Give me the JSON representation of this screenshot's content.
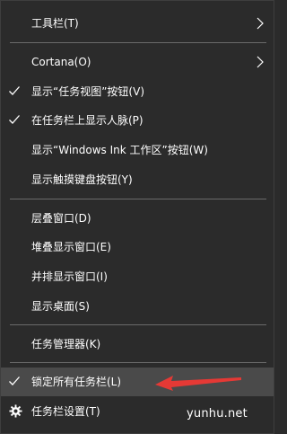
{
  "menu": {
    "items": [
      {
        "label": "工具栏(T)",
        "checked": false,
        "submenu": true
      },
      {
        "label": "Cortana(O)",
        "checked": false,
        "submenu": true
      },
      {
        "label": "显示“任务视图”按钮(V)",
        "checked": true,
        "submenu": false
      },
      {
        "label": "在任务栏上显示人脉(P)",
        "checked": true,
        "submenu": false
      },
      {
        "label": "显示“Windows Ink 工作区”按钮(W)",
        "checked": false,
        "submenu": false
      },
      {
        "label": "显示触摸键盘按钮(Y)",
        "checked": false,
        "submenu": false
      },
      {
        "label": "层叠窗口(D)",
        "checked": false,
        "submenu": false
      },
      {
        "label": "堆叠显示窗口(E)",
        "checked": false,
        "submenu": false
      },
      {
        "label": "并排显示窗口(I)",
        "checked": false,
        "submenu": false
      },
      {
        "label": "显示桌面(S)",
        "checked": false,
        "submenu": false
      },
      {
        "label": "任务管理器(K)",
        "checked": false,
        "submenu": false
      },
      {
        "label": "锁定所有任务栏(L)",
        "checked": true,
        "submenu": false,
        "highlighted": true
      },
      {
        "label": "任务栏设置(T)",
        "checked": false,
        "submenu": false,
        "icon": "gear-icon"
      }
    ]
  },
  "annotation": {
    "arrow_color": "#e53935",
    "icon": "red-arrow-icon"
  },
  "watermark": "yunhu.net",
  "colors": {
    "menu_background": "#2b2b2b",
    "highlight": "#4a4a4a",
    "separator": "#6a6a6a",
    "text": "#ffffff"
  }
}
